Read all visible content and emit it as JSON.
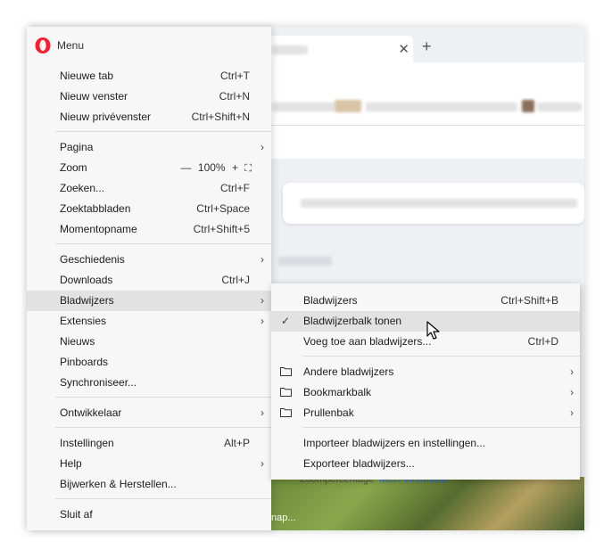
{
  "menu": {
    "title": "Menu",
    "items": [
      {
        "label": "Nieuwe tab",
        "shortcut": "Ctrl+T"
      },
      {
        "label": "Nieuw venster",
        "shortcut": "Ctrl+N"
      },
      {
        "label": "Nieuw privévenster",
        "shortcut": "Ctrl+Shift+N"
      },
      {
        "label": "Pagina",
        "shortcut": ""
      },
      {
        "label": "Zoom",
        "shortcut": ""
      },
      {
        "label": "Zoeken...",
        "shortcut": "Ctrl+F"
      },
      {
        "label": "Zoektabbladen",
        "shortcut": "Ctrl+Space"
      },
      {
        "label": "Momentopname",
        "shortcut": "Ctrl+Shift+5"
      },
      {
        "label": "Geschiedenis",
        "shortcut": ""
      },
      {
        "label": "Downloads",
        "shortcut": "Ctrl+J"
      },
      {
        "label": "Bladwijzers",
        "shortcut": ""
      },
      {
        "label": "Extensies",
        "shortcut": ""
      },
      {
        "label": "Nieuws",
        "shortcut": ""
      },
      {
        "label": "Pinboards",
        "shortcut": ""
      },
      {
        "label": "Synchroniseer...",
        "shortcut": ""
      },
      {
        "label": "Ontwikkelaar",
        "shortcut": ""
      },
      {
        "label": "Instellingen",
        "shortcut": "Alt+P"
      },
      {
        "label": "Help",
        "shortcut": ""
      },
      {
        "label": "Bijwerken & Herstellen...",
        "shortcut": ""
      },
      {
        "label": "Sluit af",
        "shortcut": ""
      }
    ],
    "zoom": {
      "minus": "—",
      "value": "100%",
      "plus": "+",
      "fullscreen": "⛶"
    }
  },
  "submenu": {
    "items": [
      {
        "label": "Bladwijzers",
        "shortcut": "Ctrl+Shift+B"
      },
      {
        "label": "Bladwijzerbalk tonen",
        "shortcut": ""
      },
      {
        "label": "Voeg toe aan bladwijzers...",
        "shortcut": "Ctrl+D"
      },
      {
        "label": "Andere bladwijzers",
        "shortcut": ""
      },
      {
        "label": "Bookmarkbalk",
        "shortcut": ""
      },
      {
        "label": "Prullenbak",
        "shortcut": ""
      },
      {
        "label": "Importeer bladwijzers en instellingen...",
        "shortcut": ""
      },
      {
        "label": "Exporteer bladwijzers...",
        "shortcut": ""
      }
    ]
  },
  "background": {
    "zoom_text": "Zoompercentage",
    "zoom_link": "Meer informatie",
    "wallpaper_caption": "nap..."
  },
  "colors": {
    "accent": "#ff1b2d",
    "highlight": "#e2e2e2",
    "link": "#2b6cd6"
  },
  "icons": {
    "logo": "opera-logo",
    "submenu_arrow": "chevron-right-icon",
    "check": "check-icon",
    "folder": "folder-icon",
    "close": "close-icon",
    "plus": "plus-icon"
  }
}
